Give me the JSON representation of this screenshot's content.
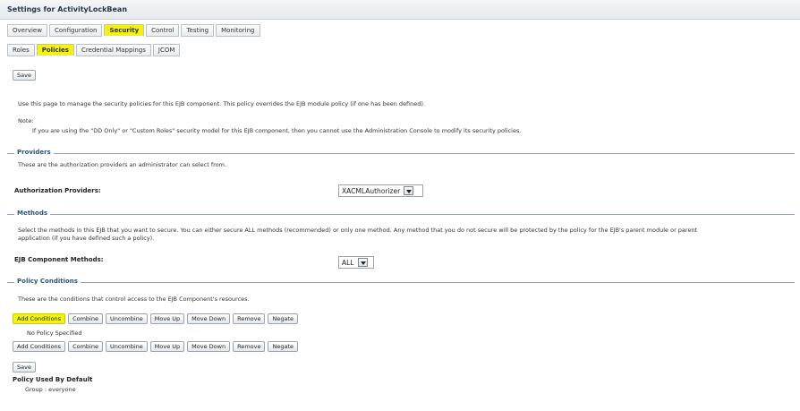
{
  "page": {
    "title": "Settings for ActivityLockBean"
  },
  "tabs": [
    {
      "label": "Overview"
    },
    {
      "label": "Configuration"
    },
    {
      "label": "Security"
    },
    {
      "label": "Control"
    },
    {
      "label": "Testing"
    },
    {
      "label": "Monitoring"
    }
  ],
  "subtabs": [
    {
      "label": "Roles"
    },
    {
      "label": "Policies"
    },
    {
      "label": "Credential Mappings"
    },
    {
      "label": "JCOM"
    }
  ],
  "save_label": "Save",
  "intro": "Use this page to manage the security policies for this EJB component. This policy overrides the EJB module policy (if one has been defined).",
  "note_label": "Note:",
  "note_text": "If you are using the \"DD Only\" or \"Custom Roles\" security model for this EJB component, then you cannot use the Administration Console to modify its security policies.",
  "providers": {
    "heading": "Providers",
    "desc": "These are the authorization providers an administrator can select from.",
    "field_label": "Authorization Providers:",
    "selected": "XACMLAuthorizer"
  },
  "methods": {
    "heading": "Methods",
    "desc_line1": "Select the methods in this EJB that you want to secure. You can either secure ALL methods (recommended) or only one method. Any method that you do not secure will be protected by the policy for the EJB's parent module or parent",
    "desc_line2": "application (if you have defined such a policy).",
    "field_label": "EJB Component Methods:",
    "selected": "ALL"
  },
  "conditions": {
    "heading": "Policy Conditions",
    "desc": "These are the conditions that control access to the EJB Component's resources.",
    "buttons": [
      "Add Conditions",
      "Combine",
      "Uncombine",
      "Move Up",
      "Move Down",
      "Remove",
      "Negate"
    ],
    "empty": "No Policy Specified"
  },
  "default_policy": {
    "heading": "Policy Used By Default",
    "value": "Group : everyone"
  },
  "colors": {
    "highlight": "#f4f40a",
    "section_title": "#2e5579"
  }
}
